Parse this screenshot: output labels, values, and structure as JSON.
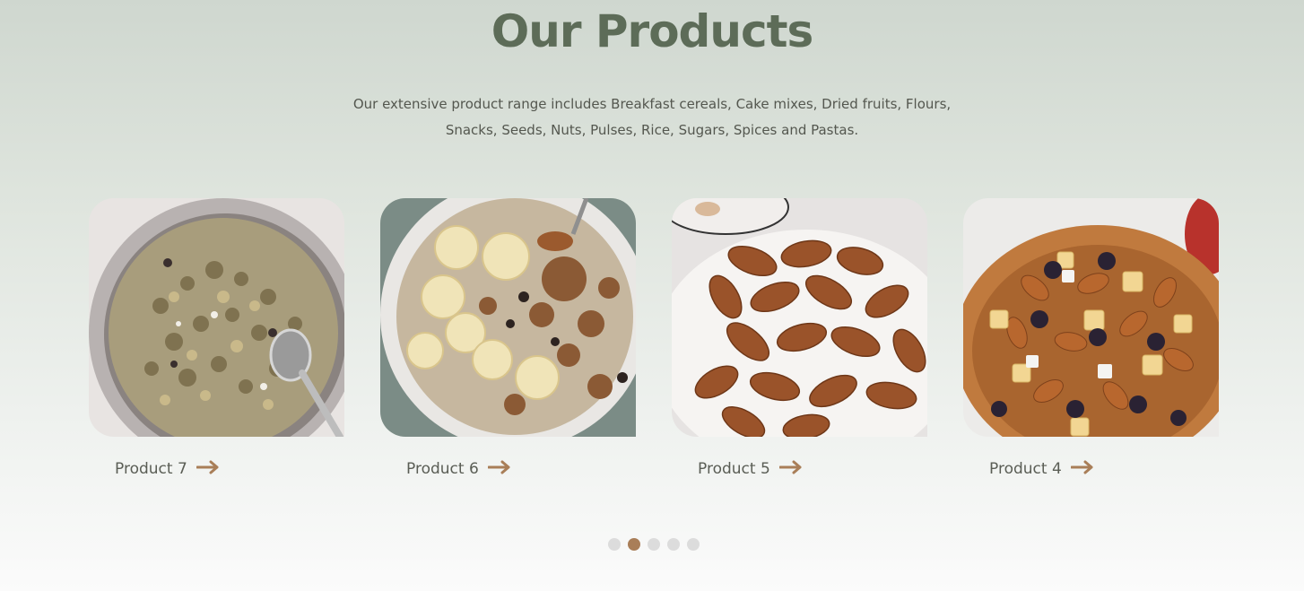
{
  "section": {
    "title": "Our Products",
    "description_line1": "Our extensive product range includes Breakfast cereals, Cake mixes, Dried fruits, Flours,",
    "description_line2": "Snacks, Seeds, Nuts, Pulses, Rice, Sugars, Spices and Pastas."
  },
  "products": [
    {
      "label": "Product 7",
      "image": "granola-bowl",
      "icon": "arrow-right-icon"
    },
    {
      "label": "Product 6",
      "image": "banana-oat-bowl",
      "icon": "arrow-right-icon"
    },
    {
      "label": "Product 5",
      "image": "almonds-plate",
      "icon": "arrow-right-icon"
    },
    {
      "label": "Product 4",
      "image": "trail-mix-bowl",
      "icon": "arrow-right-icon"
    }
  ],
  "pagination": {
    "count": 5,
    "active_index": 1
  },
  "colors": {
    "title": "#5d6c58",
    "accent": "#a97e58",
    "dot_inactive": "#dcdcdc"
  }
}
